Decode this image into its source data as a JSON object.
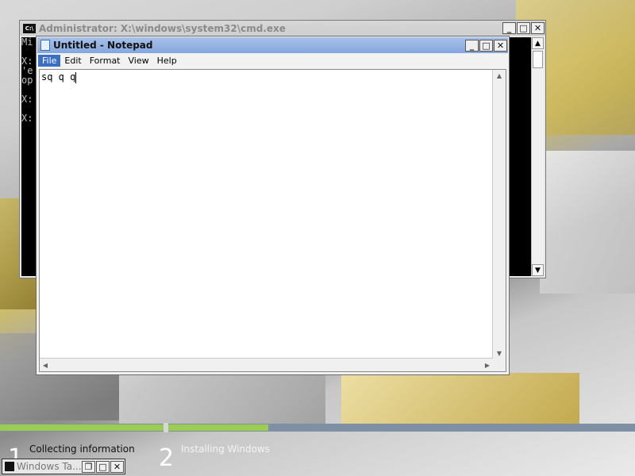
{
  "cmd_window": {
    "title": "Administrator: X:\\windows\\system32\\cmd.exe",
    "lines": [
      "Mi",
      "",
      "X:",
      "'e",
      "op",
      "",
      "X:",
      "",
      "X:"
    ],
    "buttons": {
      "minimize": "_",
      "maximize": "□",
      "close": "✕"
    }
  },
  "notepad": {
    "title": "Untitled - Notepad",
    "menu": [
      "File",
      "Edit",
      "Format",
      "View",
      "Help"
    ],
    "active_menu": "File",
    "content": "sq q q",
    "buttons": {
      "minimize": "_",
      "maximize": "□",
      "close": "✕"
    },
    "scroll_arrows": {
      "up": "▲",
      "down": "▼",
      "left": "◀",
      "right": "▶"
    }
  },
  "setup": {
    "steps": [
      {
        "number": "1",
        "label": "Collecting information"
      },
      {
        "number": "2",
        "label": "Installing Windows"
      }
    ]
  },
  "taskbar": {
    "window_title": "Windows Ta...",
    "buttons": {
      "restore": "❐",
      "maximize": "□",
      "close": "✕"
    }
  },
  "icons": {
    "cmd": "cmd-icon",
    "notepad": "notepad-icon"
  }
}
